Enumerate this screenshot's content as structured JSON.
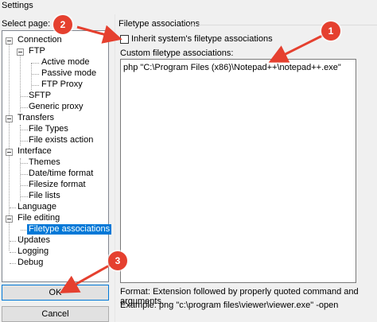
{
  "window": {
    "title": "Settings"
  },
  "select_page_label": "Select page:",
  "tree": [
    {
      "label": "Connection"
    },
    {
      "label": "FTP"
    },
    {
      "label": "Active mode"
    },
    {
      "label": "Passive mode"
    },
    {
      "label": "FTP Proxy"
    },
    {
      "label": "SFTP"
    },
    {
      "label": "Generic proxy"
    },
    {
      "label": "Transfers"
    },
    {
      "label": "File Types"
    },
    {
      "label": "File exists action"
    },
    {
      "label": "Interface"
    },
    {
      "label": "Themes"
    },
    {
      "label": "Date/time format"
    },
    {
      "label": "Filesize format"
    },
    {
      "label": "File lists"
    },
    {
      "label": "Language"
    },
    {
      "label": "File editing"
    },
    {
      "label": "Filetype associations"
    },
    {
      "label": "Updates"
    },
    {
      "label": "Logging"
    },
    {
      "label": "Debug"
    }
  ],
  "buttons": {
    "ok": "OK",
    "cancel": "Cancel"
  },
  "panel": {
    "group_title": "Filetype associations",
    "inherit_label": "Inherit system's filetype associations",
    "inherit_checked": false,
    "custom_label": "Custom filetype associations:",
    "custom_value": "php \"C:\\Program Files (x86)\\Notepad++\\notepad++.exe\"",
    "hint_format": "Format: Extension followed by properly quoted command and arguments.",
    "hint_example": "Example: png \"c:\\program files\\viewer\\viewer.exe\" -open"
  },
  "annotations": [
    {
      "number": "1"
    },
    {
      "number": "2"
    },
    {
      "number": "3"
    }
  ],
  "colors": {
    "selection": "#0078d7",
    "annotation": "#e5402f"
  }
}
